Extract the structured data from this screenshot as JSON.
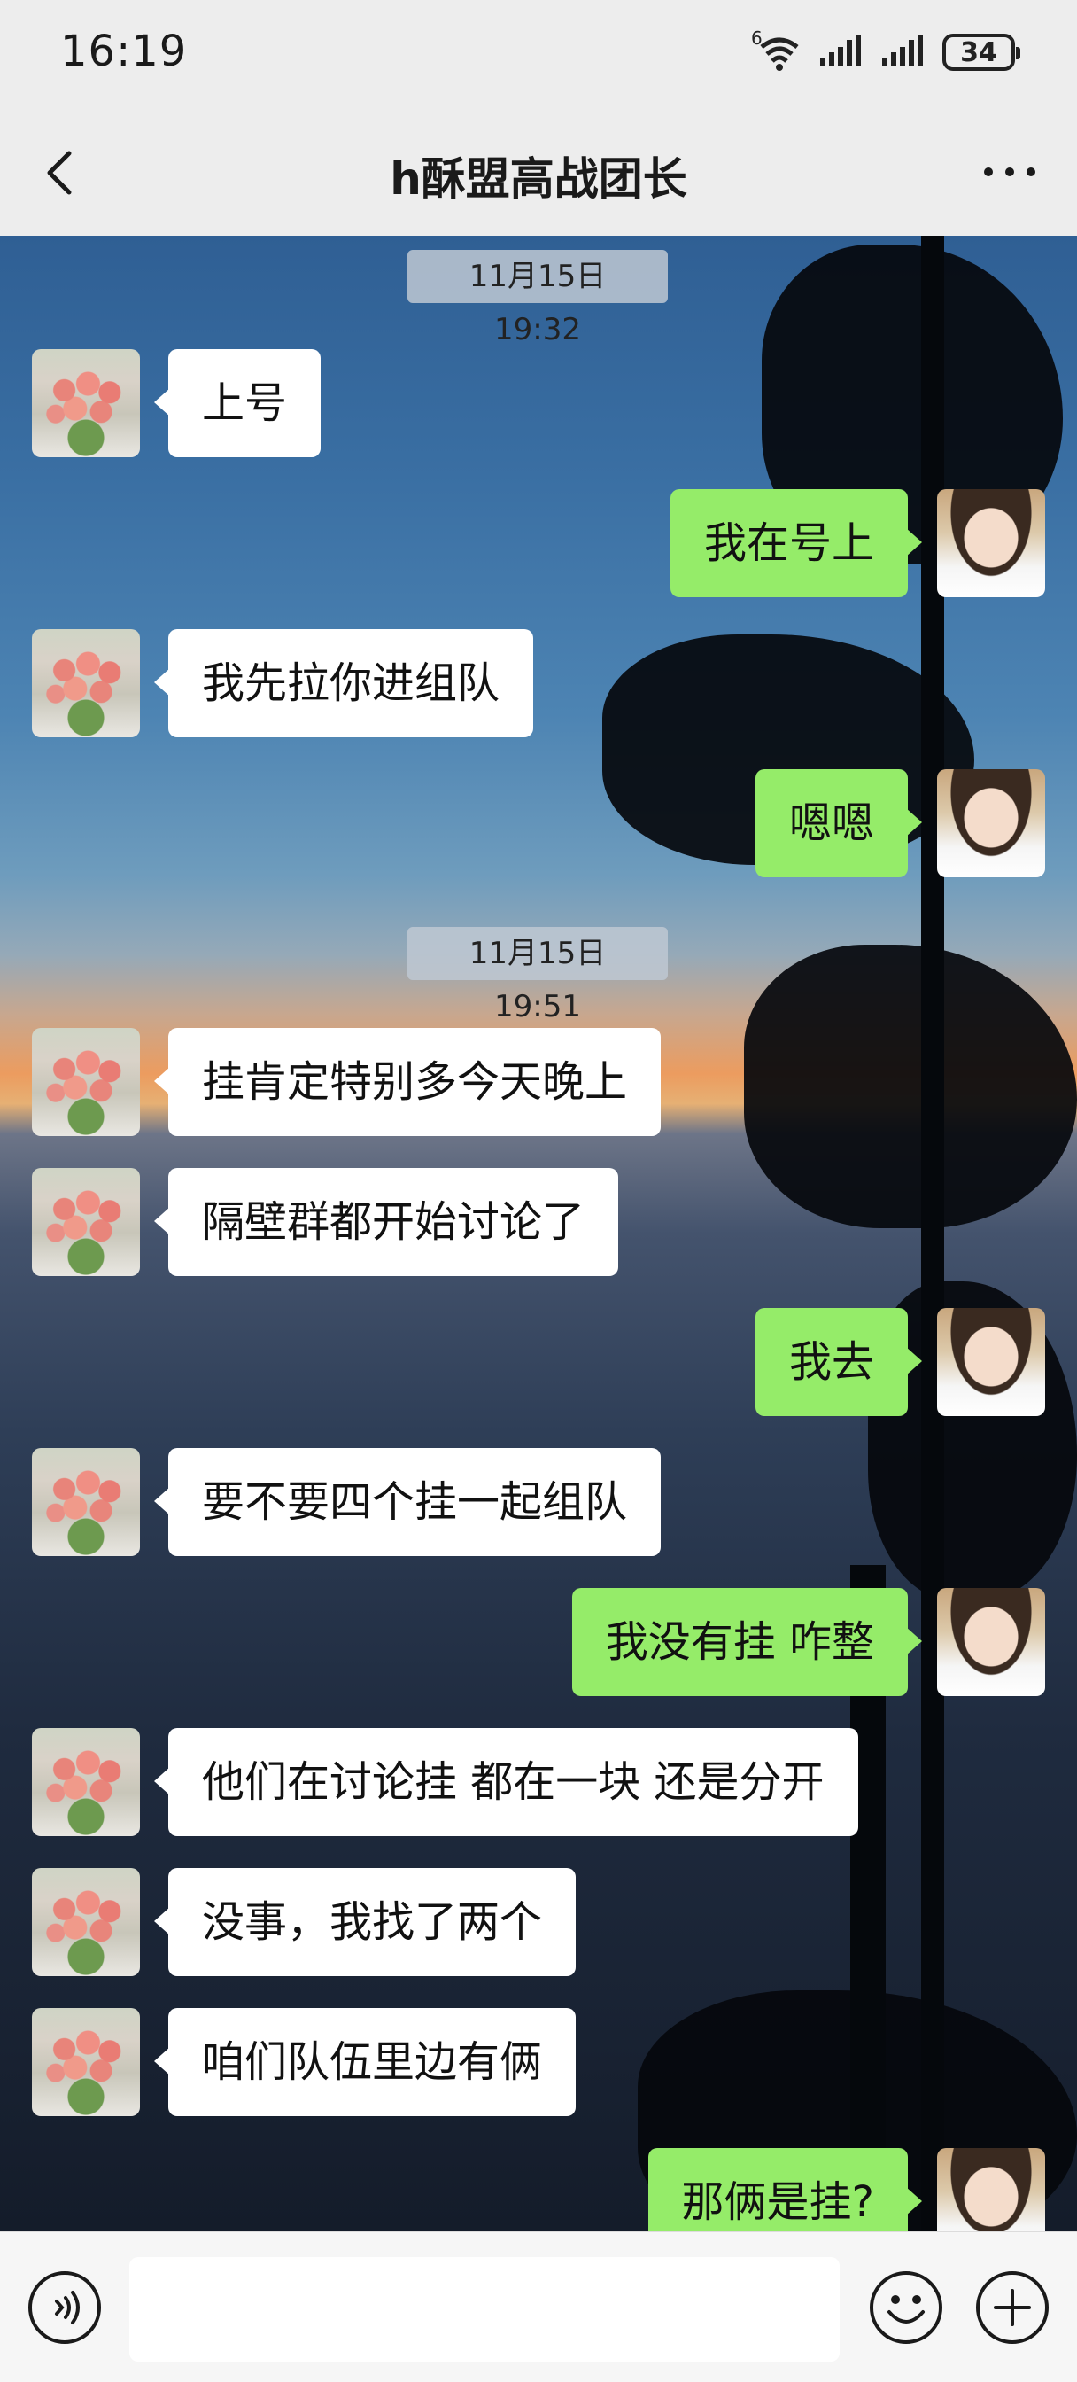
{
  "status_bar": {
    "time": "16:19",
    "battery": "34",
    "network_label": "6",
    "icons": [
      "wifi-icon",
      "signal-icon",
      "signal-icon",
      "battery-icon"
    ]
  },
  "header": {
    "title": "h酥盟高战团长",
    "back_icon": "chevron-left-icon",
    "more_icon": "more-dots-icon"
  },
  "chat": {
    "timestamps": [
      "11月15日 19:32",
      "11月15日 19:51"
    ],
    "messages": [
      {
        "side": "left",
        "text": "上号"
      },
      {
        "side": "right",
        "text": "我在号上"
      },
      {
        "side": "left",
        "text": "我先拉你进组队"
      },
      {
        "side": "right",
        "text": "嗯嗯"
      },
      {
        "side": "left",
        "text": "挂肯定特别多今天晚上"
      },
      {
        "side": "left",
        "text": "隔壁群都开始讨论了"
      },
      {
        "side": "right",
        "text": "我去"
      },
      {
        "side": "left",
        "text": "要不要四个挂一起组队"
      },
      {
        "side": "right",
        "text": "我没有挂 咋整"
      },
      {
        "side": "left",
        "text": "他们在讨论挂 都在一块 还是分开"
      },
      {
        "side": "left",
        "text": "没事，我找了两个"
      },
      {
        "side": "left",
        "text": "咱们队伍里边有俩"
      },
      {
        "side": "right",
        "text": "那俩是挂?"
      }
    ]
  },
  "input_bar": {
    "voice_icon": "voice-icon",
    "input_value": "",
    "emoji_icon": "emoji-icon",
    "plus_icon": "plus-icon"
  },
  "colors": {
    "background": "#ededed",
    "bubble_self": "#95ec69",
    "bubble_other": "#ffffff"
  }
}
